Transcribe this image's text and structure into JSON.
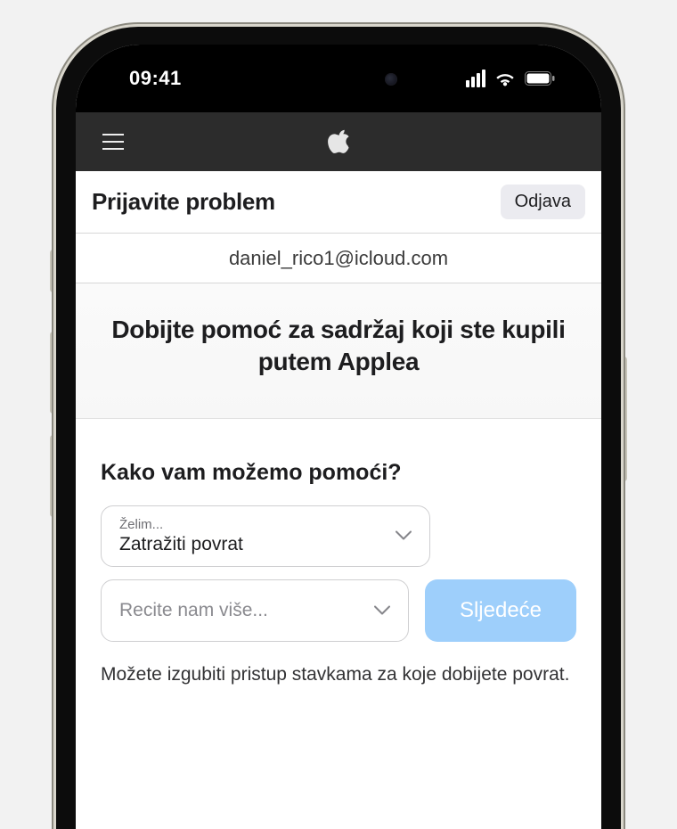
{
  "statusbar": {
    "time": "09:41"
  },
  "titlebar": {
    "title": "Prijavite problem",
    "logout_label": "Odjava"
  },
  "account": {
    "email": "daniel_rico1@icloud.com"
  },
  "hero": {
    "heading": "Dobijte pomoć za sadržaj koji ste kupili putem Applea"
  },
  "form": {
    "question": "Kako vam možemo pomoći?",
    "want_label": "Želim...",
    "want_value": "Zatražiti povrat",
    "tell_more_placeholder": "Recite nam više...",
    "next_label": "Sljedeće",
    "note": "Možete izgubiti pristup stavkama za koje dobijete povrat."
  }
}
